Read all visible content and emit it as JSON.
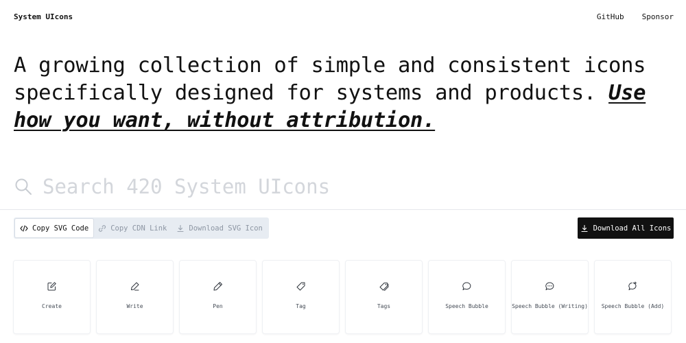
{
  "nav": {
    "brand": "System UIcons",
    "links": [
      "GitHub",
      "Sponsor"
    ]
  },
  "hero": {
    "text": "A growing collection of simple and consistent icons specifically designed for systems and products. ",
    "emphasis": "Use how you want, without attribution."
  },
  "search": {
    "placeholder": "Search 420 System UIcons",
    "icon": "search-icon"
  },
  "toolbar": {
    "copy_options": [
      {
        "label": "Copy SVG Code",
        "icon": "code-icon",
        "active": true
      },
      {
        "label": "Copy CDN Link",
        "icon": "link-icon",
        "active": false
      },
      {
        "label": "Download SVG Icon",
        "icon": "download-icon",
        "active": false
      }
    ],
    "download_all_label": "Download All Icons"
  },
  "icons": [
    {
      "label": "Create",
      "icon": "create-icon"
    },
    {
      "label": "Write",
      "icon": "write-icon"
    },
    {
      "label": "Pen",
      "icon": "pen-icon"
    },
    {
      "label": "Tag",
      "icon": "tag-icon"
    },
    {
      "label": "Tags",
      "icon": "tags-icon"
    },
    {
      "label": "Speech Bubble",
      "icon": "speech-bubble-icon"
    },
    {
      "label": "Speech Bubble (Writing)",
      "icon": "speech-bubble-writing-icon"
    },
    {
      "label": "Speech Bubble (Add)",
      "icon": "speech-bubble-add-icon"
    }
  ],
  "colors": {
    "accent": "#111111",
    "toolbar_bg": "#e7ecf2",
    "muted_text": "#8d96a3",
    "placeholder": "#d3d6db"
  }
}
